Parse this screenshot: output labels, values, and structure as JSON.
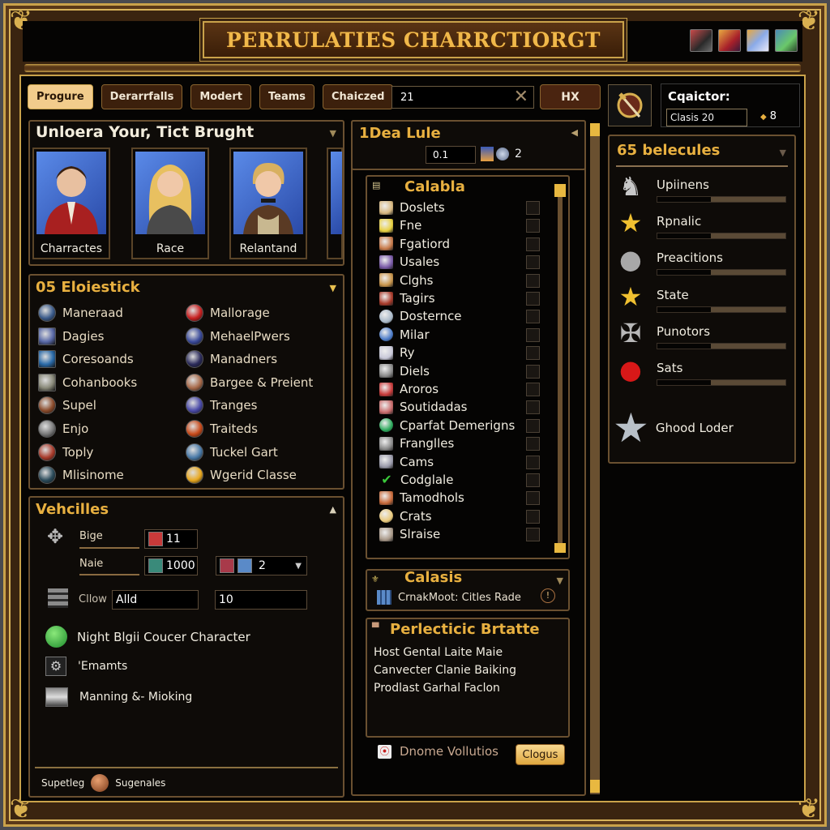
{
  "window": {
    "title": "PERRULATIES CHARRCTIORGT",
    "title_icons": [
      "weapon-card-icon",
      "shield-card-icon",
      "mage-card-icon",
      "nature-card-icon"
    ]
  },
  "toolbar": {
    "tabs": [
      {
        "label": "Progure",
        "active": true
      },
      {
        "label": "Derarrfalls",
        "active": false
      },
      {
        "label": "Modert",
        "active": false
      },
      {
        "label": "Teams",
        "active": false
      },
      {
        "label": "Chaiczed",
        "active": false
      }
    ],
    "search_value": "21",
    "hx_label": "HX",
    "character_label": "Cqaictor:",
    "character_class_value": "Clasis 20",
    "character_count": "8"
  },
  "portraits_panel": {
    "title": "Unloera Your, Tict Brught",
    "portraits": [
      {
        "label": "Charractes"
      },
      {
        "label": "Race"
      },
      {
        "label": "Relantand"
      }
    ]
  },
  "elements_panel": {
    "title": "05 Eloiestick",
    "left": [
      {
        "label": "Maneraad",
        "icon": "crystal-orb-icon",
        "color": "#3a5a8a"
      },
      {
        "label": "Dagies",
        "icon": "mage-portrait-icon",
        "color": "#5a6aa8"
      },
      {
        "label": "Coresoands",
        "icon": "blue-rune-icon",
        "color": "#2a6aa8"
      },
      {
        "label": "Cohanbooks",
        "icon": "stone-tablet-icon",
        "color": "#8a8a7a"
      },
      {
        "label": "Supel",
        "icon": "bronze-medallion-icon",
        "color": "#8a4a2a"
      },
      {
        "label": "Enjo",
        "icon": "silver-orb-icon",
        "color": "#7a7a7a"
      },
      {
        "label": "Toply",
        "icon": "golden-crown-icon",
        "color": "#a83a2a"
      },
      {
        "label": "Mlisinome",
        "icon": "teal-orb-icon",
        "color": "#2a4a5a"
      }
    ],
    "right": [
      {
        "label": "Mallorage",
        "icon": "red-badge-icon",
        "color": "#c82020"
      },
      {
        "label": "MehaelPwers",
        "icon": "blue-power-orb-icon",
        "color": "#3a4a9a"
      },
      {
        "label": "Manadners",
        "icon": "dark-portal-icon",
        "color": "#2a2a5a"
      },
      {
        "label": "Bargee & Preient",
        "icon": "face-medallion-icon",
        "color": "#a86a4a"
      },
      {
        "label": "Tranges",
        "icon": "lightning-orb-icon",
        "color": "#4a4aa8"
      },
      {
        "label": "Traiteds",
        "icon": "fire-orb-icon",
        "color": "#c84a1a"
      },
      {
        "label": "Tuckel Gart",
        "icon": "landscape-orb-icon",
        "color": "#4a7aa8"
      },
      {
        "label": "Wgerid Classe",
        "icon": "gold-coin-icon",
        "color": "#e8a820"
      }
    ]
  },
  "vehicles_panel": {
    "title": "Vehcilles",
    "bige_label": "Bige",
    "bige_value": "11",
    "name_label": "Naie",
    "name_value": "1000",
    "dropdown_value": "2",
    "clow_label": "Cllow",
    "clow_value": "Alld",
    "clow_value2": "10",
    "actions": [
      {
        "label": "Night Blgii Coucer Character",
        "icon": "green-check-orb-icon"
      },
      {
        "label": "'Emamts",
        "icon": "gear-emblem-icon"
      },
      {
        "label": "Manning &- Mioking",
        "icon": "castle-scene-icon"
      }
    ],
    "footer_left": "Supetleg",
    "footer_right": "Sugenales"
  },
  "idea_panel": {
    "title": "1Dea Lule",
    "value_input": "0.1",
    "count": "2"
  },
  "calabla_list": {
    "title": "Calabla",
    "items": [
      {
        "label": "Doslets",
        "icon": "scroll-portrait-icon",
        "color": "#d8b880"
      },
      {
        "label": "Fne",
        "icon": "sunburst-icon",
        "color": "#e8d040"
      },
      {
        "label": "Fgatiord",
        "icon": "warrior-portrait-icon",
        "color": "#c87a4a"
      },
      {
        "label": "Usales",
        "icon": "purple-tome-icon",
        "color": "#7a5aa8"
      },
      {
        "label": "Clghs",
        "icon": "parchment-icon",
        "color": "#c8944a"
      },
      {
        "label": "Tagirs",
        "icon": "red-banner-icon",
        "color": "#a83a2a"
      },
      {
        "label": "Dosternce",
        "icon": "silver-globe-icon",
        "color": "#a8b8c8"
      },
      {
        "label": "Milar",
        "icon": "blue-globe-icon",
        "color": "#4a7ac8"
      },
      {
        "label": "Ry",
        "icon": "helmet-icon",
        "color": "#c8c8d8"
      },
      {
        "label": "Diels",
        "icon": "anvil-icon",
        "color": "#8a8a8a"
      },
      {
        "label": "Aroros",
        "icon": "crossed-arrows-icon",
        "color": "#c83a3a"
      },
      {
        "label": "Soutidadas",
        "icon": "map-scroll-icon",
        "color": "#c86a6a"
      },
      {
        "label": "Cparfat Demerigns",
        "icon": "green-emblem-icon",
        "color": "#2aa85a"
      },
      {
        "label": "Franglles",
        "icon": "tower-icon",
        "color": "#8a8a8a"
      },
      {
        "label": "Cams",
        "icon": "camera-icon",
        "color": "#9a9aaa"
      },
      {
        "label": "Codglale",
        "icon": "checkmark-icon",
        "color": "#3ac83a"
      },
      {
        "label": "Tamodhols",
        "icon": "campfire-icon",
        "color": "#c86a3a"
      },
      {
        "label": "Crats",
        "icon": "compass-icon",
        "color": "#e8c87a"
      },
      {
        "label": "Slraise",
        "icon": "stone-face-icon",
        "color": "#aa9a8a"
      }
    ]
  },
  "calasis_panel": {
    "title": "Calasis",
    "row_label": "CrnakMoot: Citles Rade"
  },
  "perfecticic_panel": {
    "title": "Perlecticic Brtatte",
    "lines": [
      "Host Gental Laite Maie",
      "Canvecter Clanie Baiking",
      "Prodlast Garhal Faclon"
    ],
    "link_label": "Dnome Vollutios",
    "button_label": "Clogus"
  },
  "stats_panel": {
    "title": "65 belecules",
    "stats": [
      {
        "label": "Upiinens",
        "icon": "knight-figure-icon",
        "progress": 0.42
      },
      {
        "label": "Rpnalic",
        "icon": "gold-star-icon",
        "progress": 0.42
      },
      {
        "label": "Preacitions",
        "icon": "silver-coin-icon",
        "progress": 0.42
      },
      {
        "label": "State",
        "icon": "gold-star-icon",
        "progress": 0.42
      },
      {
        "label": "Punotors",
        "icon": "crossbow-icon",
        "progress": 0.42
      },
      {
        "label": "Sats",
        "icon": "red-gem-icon",
        "progress": 0.42
      }
    ],
    "footer_label": "Ghood Loder",
    "footer_icon": "silver-star-icon"
  }
}
